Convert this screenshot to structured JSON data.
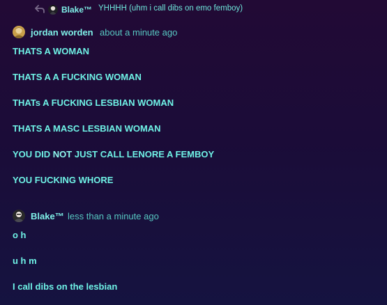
{
  "reply": {
    "author": "Blake™",
    "text": "YHHHH (uhm i call dibs on emo femboy)",
    "icon": "reply-arrow-icon"
  },
  "messages": [
    {
      "author": "jordan worden",
      "timestamp": "about a minute ago",
      "avatar_color": "#c9a04a",
      "lines": [
        {
          "text": "THATS A WOMAN"
        },
        {
          "text": "THATS A A FUCKING WOMAN"
        },
        {
          "text": "THATs A FUCKING LESBIAN WOMAN"
        },
        {
          "text": "THATS A MASC LESBIAN WOMAN"
        },
        {
          "pre": "YOU DID ",
          "bold": "NOT",
          "post": " JUST CALL LENORE A FEMBOY"
        },
        {
          "text": "YOU FUCKING WHORE"
        }
      ]
    },
    {
      "author": "Blake™",
      "timestamp": "less than a minute ago",
      "avatar_color": "#2a2a2a",
      "lines": [
        {
          "text": "o h"
        },
        {
          "text": "u h m"
        },
        {
          "text": "I call dibs on the lesbian"
        }
      ]
    }
  ],
  "colors": {
    "author": "#7ff0e8",
    "message_text": "#6ff2e6",
    "timestamp": "#57c8c2",
    "background_top": "#220a35",
    "background_bottom": "#151340"
  }
}
